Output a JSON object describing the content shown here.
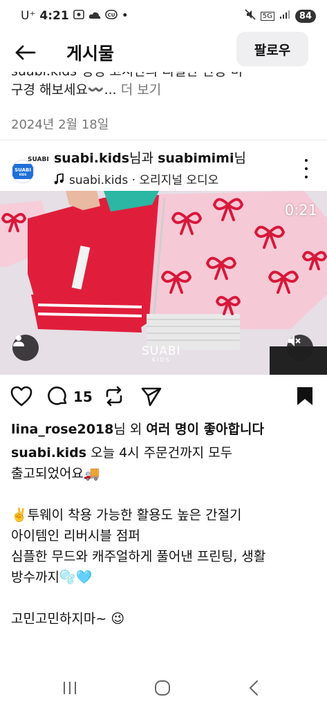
{
  "status_bar": {
    "carrier": "U⁺",
    "time": "4:21",
    "dot": "•",
    "network": "5G",
    "battery": "84"
  },
  "app_bar": {
    "title": "게시물",
    "follow_label": "팔로우"
  },
  "previous_post": {
    "caption_top": "suabi.kids 생생 코치단의 리얼한 반응 미",
    "caption_line2": "구경 해보세요〰️...",
    "more_label": "더 보기",
    "date": "2024년 2월 18일"
  },
  "post": {
    "avatar_text": "SUABI",
    "avatar_sub": "KIDS",
    "avatar_tag": "SUABI",
    "author_1": "suabi.kids",
    "author_join": "님과",
    "author_2": "suabimimi",
    "author_suffix": "님",
    "audio": "suabi.kids · 오리지널 오디오",
    "video_time": "0:21",
    "watermark": "SUABI",
    "watermark_sub": "KIDS",
    "comment_count": "15",
    "likes_user": "lina_rose2018",
    "likes_mid": "님 외",
    "likes_rest": "여러 명이 좋아합니다",
    "caption_user": "suabi.kids",
    "caption_line1": "오늘 4시 주문건까지 모두",
    "caption_line2": "출고되었어요🚚",
    "caption_line3": "",
    "caption_line4": "✌️투웨이 착용 가능한 활용도 높은 간절기",
    "caption_line5": "아이템인 리버시블 점퍼",
    "caption_line6": "심플한 무드와 캐주얼하게 풀어낸 프린팅, 생활",
    "caption_line7": "방수까지🫧🩵",
    "caption_line8": "",
    "caption_line9": "고민고민하지마~ 😉"
  },
  "icons": {
    "back": "arrow-left-icon",
    "more": "kebab-icon",
    "music": "music-note-icon",
    "like": "heart-icon",
    "comment": "comment-icon",
    "repost": "repost-icon",
    "share": "send-icon",
    "save": "bookmark-icon",
    "user_tag": "person-icon",
    "mute": "muted-speaker-icon"
  },
  "colors": {
    "accent": "#1f6fd8",
    "jacket_red": "#e01e3c",
    "jacket_pink": "#f6c9d6",
    "follow_bg": "#efeff2"
  }
}
